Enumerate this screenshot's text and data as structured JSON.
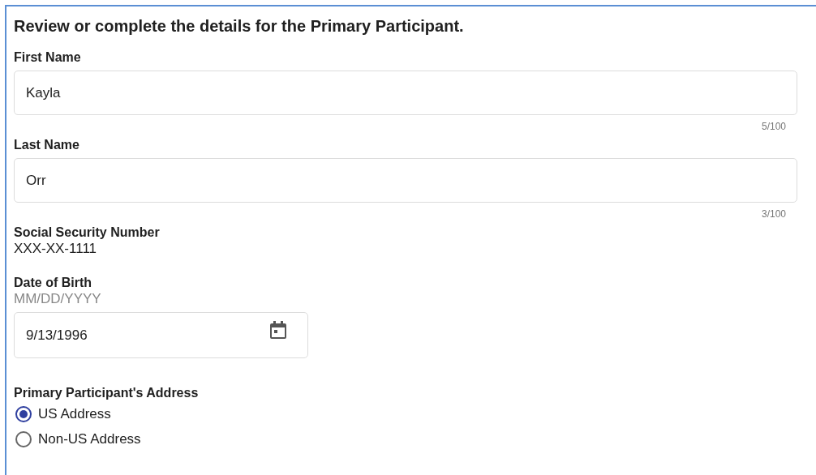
{
  "heading": "Review or complete the details for the Primary Participant.",
  "text_fields": [
    {
      "label": "First Name",
      "value": "Kayla",
      "counter": "5/100"
    },
    {
      "label": "Last Name",
      "value": "Orr",
      "counter": "3/100"
    }
  ],
  "ssn": {
    "label": "Social Security Number",
    "value": "XXX-XX-1111"
  },
  "date_of_birth": {
    "label": "Date of Birth",
    "hint": "MM/DD/YYYY",
    "value": "9/13/1996"
  },
  "address": {
    "label": "Primary Participant's Address",
    "options": [
      {
        "label": "US Address",
        "selected": true
      },
      {
        "label": "Non-US Address",
        "selected": false
      }
    ]
  }
}
